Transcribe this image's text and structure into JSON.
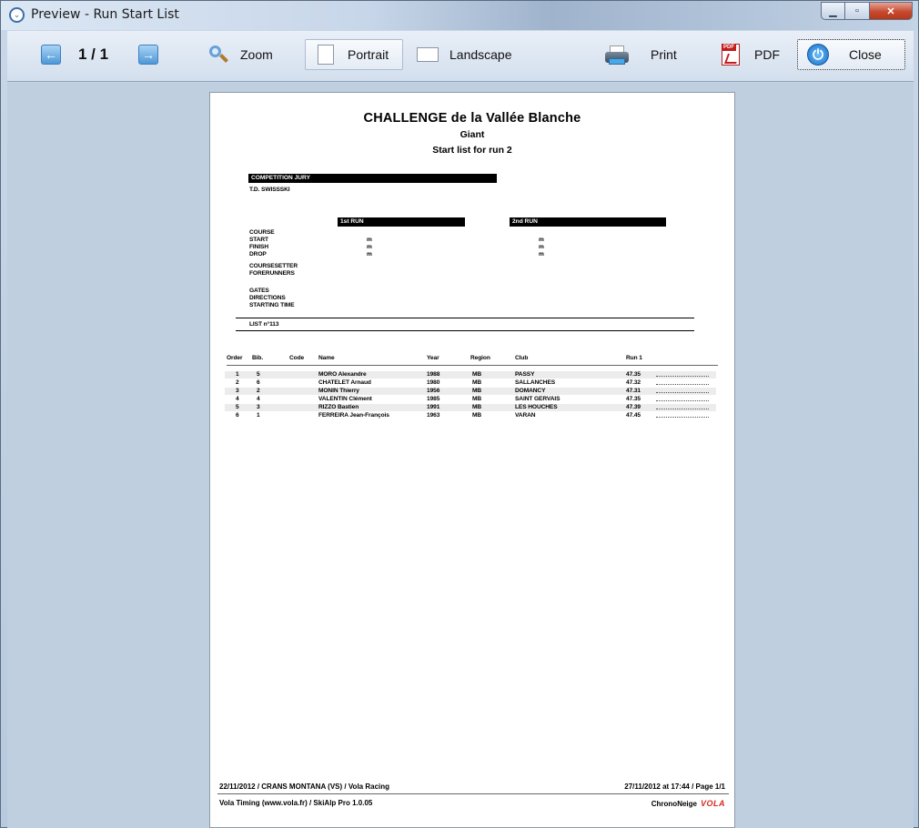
{
  "window": {
    "title": "Preview - Run Start List"
  },
  "toolbar": {
    "page_indicator": "1 / 1",
    "zoom_label": "Zoom",
    "portrait_label": "Portrait",
    "landscape_label": "Landscape",
    "print_label": "Print",
    "pdf_label": "PDF",
    "close_label": "Close"
  },
  "document": {
    "title": "CHALLENGE de la Vallée Blanche",
    "discipline": "Giant",
    "subtitle": "Start list for run 2",
    "jury_header": "COMPETITION JURY",
    "td_line": "T.D. SWISSSKI",
    "run1_header": "1st RUN",
    "run2_header": "2nd RUN",
    "course_labels": [
      "COURSE",
      "START",
      "FINISH",
      "DROP"
    ],
    "unit": "m",
    "other_labels": [
      "COURSESETTER",
      "FORERUNNERS"
    ],
    "gates_labels": [
      "GATES",
      "DIRECTIONS",
      "STARTING TIME"
    ],
    "list_no": "LIST n°113",
    "columns": {
      "order": "Order",
      "bib": "Bib.",
      "code": "Code",
      "name": "Name",
      "year": "Year",
      "region": "Region",
      "club": "Club",
      "run1": "Run 1"
    },
    "rows": [
      {
        "order": "1",
        "bib": "5",
        "name": "MORO Alexandre",
        "year": "1988",
        "region": "MB",
        "club": "PASSY",
        "run1": "47.35"
      },
      {
        "order": "2",
        "bib": "6",
        "name": "CHATELET Arnaud",
        "year": "1980",
        "region": "MB",
        "club": "SALLANCHES",
        "run1": "47.32"
      },
      {
        "order": "3",
        "bib": "2",
        "name": "MONIN Thierry",
        "year": "1956",
        "region": "MB",
        "club": "DOMANCY",
        "run1": "47.31"
      },
      {
        "order": "4",
        "bib": "4",
        "name": "VALENTIN Clément",
        "year": "1985",
        "region": "MB",
        "club": "SAINT GERVAIS",
        "run1": "47.35"
      },
      {
        "order": "5",
        "bib": "3",
        "name": "RIZZO Bastien",
        "year": "1991",
        "region": "MB",
        "club": "LES HOUCHES",
        "run1": "47.39"
      },
      {
        "order": "6",
        "bib": "1",
        "name": "FERREIRA Jean-François",
        "year": "1963",
        "region": "MB",
        "club": "VARAN",
        "run1": "47.45"
      }
    ],
    "footer_left_1": "22/11/2012  /  CRANS MONTANA (VS)  /  Vola Racing",
    "footer_right_1": "27/11/2012 at 17:44  /  Page 1/1",
    "footer_left_2": "Vola Timing (www.vola.fr) / SkiAlp Pro 1.0.05",
    "footer_right_2": "ChronoNeige",
    "footer_logo": "VOLA"
  }
}
